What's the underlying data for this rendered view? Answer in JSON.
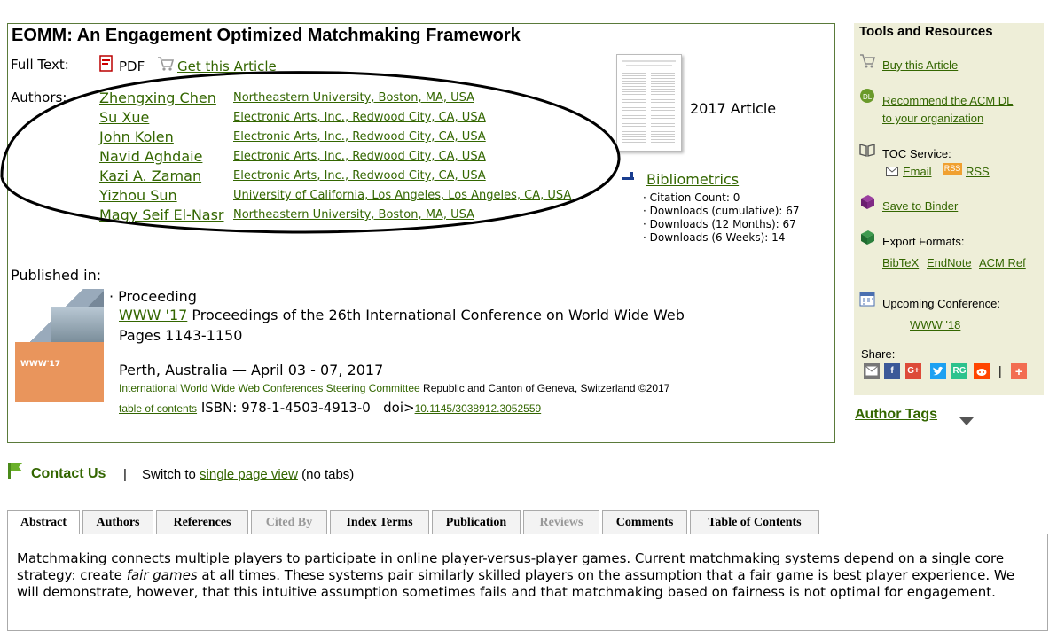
{
  "article": {
    "title": "EOMM: An Engagement Optimized Matchmaking Framework",
    "full_text_label": "Full Text:",
    "pdf_label": "PDF",
    "get_article_label": "Get this Article",
    "authors_label": "Authors:",
    "article_type": "2017 Article",
    "authors": [
      {
        "name": "Zhengxing Chen",
        "affiliation": "Northeastern University, Boston, MA, USA"
      },
      {
        "name": "Su Xue",
        "affiliation": "Electronic Arts, Inc., Redwood City, CA, USA"
      },
      {
        "name": "John Kolen",
        "affiliation": "Electronic Arts, Inc., Redwood City, CA, USA"
      },
      {
        "name": "Navid Aghdaie",
        "affiliation": "Electronic Arts, Inc., Redwood City, CA, USA"
      },
      {
        "name": "Kazi A. Zaman",
        "affiliation": "Electronic Arts, Inc., Redwood City, CA, USA"
      },
      {
        "name": "Yizhou Sun",
        "affiliation": "University of California, Los Angeles, Los Angeles, CA, USA"
      },
      {
        "name": "Magy Seif El-Nasr",
        "affiliation": "Northeastern University, Boston, MA, USA"
      }
    ]
  },
  "bibliometrics": {
    "label": "Bibliometrics",
    "items": [
      "· Citation Count: 0",
      "· Downloads (cumulative): 67",
      "· Downloads (12 Months): 67",
      "· Downloads (6 Weeks): 14"
    ]
  },
  "published": {
    "label": "Published in:",
    "type": "· Proceeding",
    "venue_link": "WWW '17",
    "venue_text": " Proceedings of the 26th International Conference on World Wide Web",
    "pages": "Pages 1143-1150",
    "location": "Perth, Australia — April 03 - 07, 2017",
    "publisher_link": "International World Wide Web Conferences Steering Committee",
    "publisher_rest": " Republic and Canton of Geneva, Switzerland ©2017",
    "toc_link": "table of contents",
    "isbn": " ISBN: 978-1-4503-4913-0",
    "doi_label": "   doi>",
    "doi_link": "10.1145/3038912.3052559",
    "cover_text": "WWW'17"
  },
  "sidebar": {
    "title": "Tools and Resources",
    "buy": "Buy this Article",
    "recommend_1": "Recommend the ACM DL",
    "recommend_2": "to your organization",
    "toc_service": "TOC Service:",
    "email": "Email",
    "rss_badge": "RSS",
    "rss": "RSS",
    "binder": "Save to Binder",
    "export": "Export Formats:",
    "bibtex": "BibTeX",
    "endnote": "EndNote",
    "acmref": "ACM Ref",
    "upcoming": "Upcoming Conference:",
    "upcoming_link": "WWW '18",
    "share": "Share:",
    "share_icons": {
      "facebook": "f",
      "google": "G+",
      "rg": "RG",
      "plus": "+",
      "divider": "|"
    },
    "author_tags": "Author Tags"
  },
  "contact": {
    "label": "Contact Us",
    "divider": "|",
    "switch_pre": "Switch to ",
    "switch_link": "single page view",
    "switch_post": " (no tabs)"
  },
  "tabs": [
    {
      "label": "Abstract",
      "state": "active"
    },
    {
      "label": "Authors",
      "state": "normal"
    },
    {
      "label": "References",
      "state": "normal"
    },
    {
      "label": "Cited By",
      "state": "disabled"
    },
    {
      "label": "Index Terms",
      "state": "normal"
    },
    {
      "label": "Publication",
      "state": "normal"
    },
    {
      "label": "Reviews",
      "state": "disabled"
    },
    {
      "label": "Comments",
      "state": "normal"
    },
    {
      "label": "Table of Contents",
      "state": "normal"
    }
  ],
  "abstract": {
    "part1": "Matchmaking connects multiple players to participate in online player-versus-player games. Current matchmaking systems depend on a single core strategy: create ",
    "emphasis": "fair games",
    "part2": " at all times. These systems pair similarly skilled players on the assumption that a fair game is best player experience. We will demonstrate, however, that this intuitive assumption sometimes fails and that matchmaking based on fairness is not optimal for engagement."
  },
  "colors": {
    "link": "#336600",
    "sidebar_bg": "#eeeed8",
    "annotation_ellipse": "#000000"
  }
}
